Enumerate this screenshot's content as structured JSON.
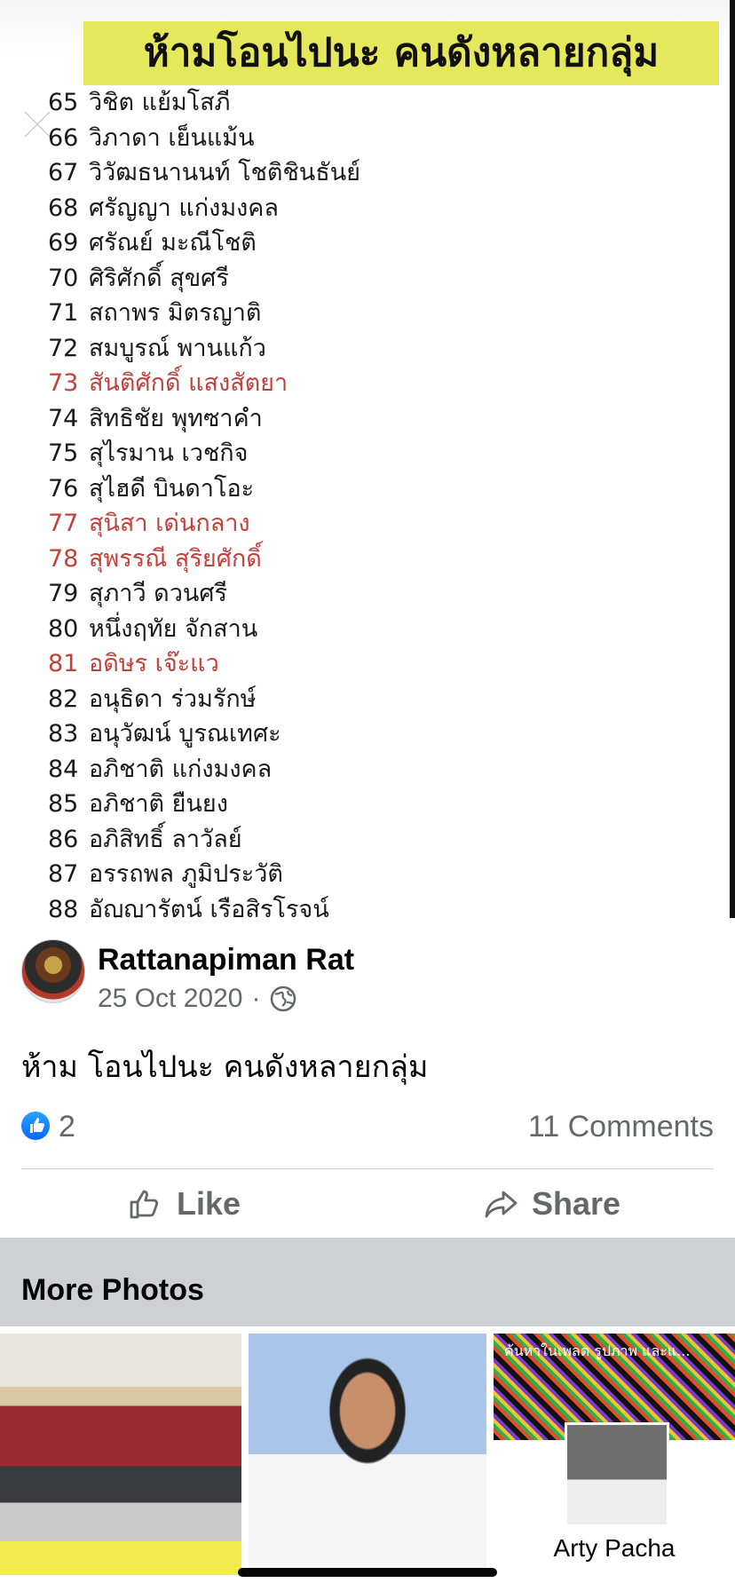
{
  "photo": {
    "title": "ห้ามโอนไปนะ คนดังหลายกลุ่ม",
    "names": [
      {
        "num": "65",
        "name": "วิชิต แย้มโสภี",
        "highlight": false
      },
      {
        "num": "66",
        "name": "วิภาดา เย็นแม้น",
        "highlight": false
      },
      {
        "num": "67",
        "name": "วิวัฒธนานนท์ โชติชินธันย์",
        "highlight": false
      },
      {
        "num": "68",
        "name": "ศรัญญา แก่งมงคล",
        "highlight": false
      },
      {
        "num": "69",
        "name": "ศรัณย์ มะณีโชติ",
        "highlight": false
      },
      {
        "num": "70",
        "name": "ศิริศักดิ์ สุขศรี",
        "highlight": false
      },
      {
        "num": "71",
        "name": "สถาพร มิตรญาติ",
        "highlight": false
      },
      {
        "num": "72",
        "name": "สมบูรณ์ พานแก้ว",
        "highlight": false
      },
      {
        "num": "73",
        "name": "สันติศักดิ์ แสงสัตยา",
        "highlight": true
      },
      {
        "num": "74",
        "name": "สิทธิชัย พุทซาคำ",
        "highlight": false
      },
      {
        "num": "75",
        "name": "สุไรมาน เวชกิจ",
        "highlight": false
      },
      {
        "num": "76",
        "name": "สุไฮดี บินดาโอะ",
        "highlight": false
      },
      {
        "num": "77",
        "name": "สุนิสา เด่นกลาง",
        "highlight": true
      },
      {
        "num": "78",
        "name": "สุพรรณี สุริยศักดิ์",
        "highlight": true
      },
      {
        "num": "79",
        "name": "สุภาวี ดวนศรี",
        "highlight": false
      },
      {
        "num": "80",
        "name": "หนึ่งฤทัย จักสาน",
        "highlight": false
      },
      {
        "num": "81",
        "name": "อดิษร เจ๊ะแว",
        "highlight": true
      },
      {
        "num": "82",
        "name": "อนุธิดา ร่วมรักษ์",
        "highlight": false
      },
      {
        "num": "83",
        "name": "อนุวัฒน์ บูรณเทศะ",
        "highlight": false
      },
      {
        "num": "84",
        "name": "อภิชาติ แก่งมงคล",
        "highlight": false
      },
      {
        "num": "85",
        "name": "อภิชาติ ยืนยง",
        "highlight": false
      },
      {
        "num": "86",
        "name": "อภิสิทธิ์ ลาวัลย์",
        "highlight": false
      },
      {
        "num": "87",
        "name": "อรรถพล ภูมิประวัติ",
        "highlight": false
      },
      {
        "num": "88",
        "name": "อัญญารัตน์ เรือสิรโรจน์",
        "highlight": false
      }
    ]
  },
  "post": {
    "author": "Rattanapiman Rat",
    "date": "25 Oct 2020",
    "separator": "·",
    "caption": "ห้าม โอนไปนะ คนดังหลายกลุ่ม",
    "like_count": "2",
    "comments": "11 Comments",
    "like_label": "Like",
    "share_label": "Share"
  },
  "more_photos": {
    "title": "More Photos",
    "third_search": "ค้นหาในเพลต รูปภาพ และแ...",
    "third_name": "Arty Pacha"
  },
  "colors": {
    "accent": "#0866ff",
    "highlight_name": "#c2413b",
    "title_bg": "#e6e85c",
    "secondary_text": "#65676b",
    "section_bg": "#ced0d4"
  },
  "icons": [
    "close-icon",
    "globe-icon",
    "like-reaction-icon",
    "thumbs-up-icon",
    "share-arrow-icon"
  ]
}
